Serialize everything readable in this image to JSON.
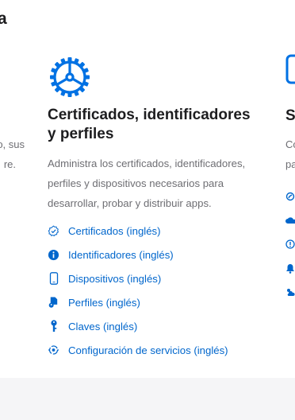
{
  "left_column": {
    "heading_fragment": "a",
    "description_fragments": [
      "o, sus",
      "re."
    ]
  },
  "card": {
    "icon": "gear-icon",
    "title": "Certificados, identificadores y perfiles",
    "description": "Administra los certificados, identificadores, perfiles y dispositivos necesarios para desarrollar, probar y distribuir apps.",
    "links": [
      {
        "icon": "badge-check-icon",
        "label": "Certificados (inglés)"
      },
      {
        "icon": "info-icon",
        "label": "Identificadores (inglés)"
      },
      {
        "icon": "device-icon",
        "label": "Dispositivos (inglés)"
      },
      {
        "icon": "profile-document-icon",
        "label": "Perfiles (inglés)"
      },
      {
        "icon": "key-icon",
        "label": "Claves (inglés)"
      },
      {
        "icon": "services-config-icon",
        "label": "Configuración de servicios (inglés)"
      }
    ]
  },
  "right_column": {
    "heading_fragment": "S",
    "description_fragments": [
      "Co",
      "pa"
    ]
  },
  "colors": {
    "accent": "#0066cc",
    "text": "#1d1d1f",
    "secondary_text": "#6e6e73",
    "footer_background": "#f5f5f7"
  }
}
